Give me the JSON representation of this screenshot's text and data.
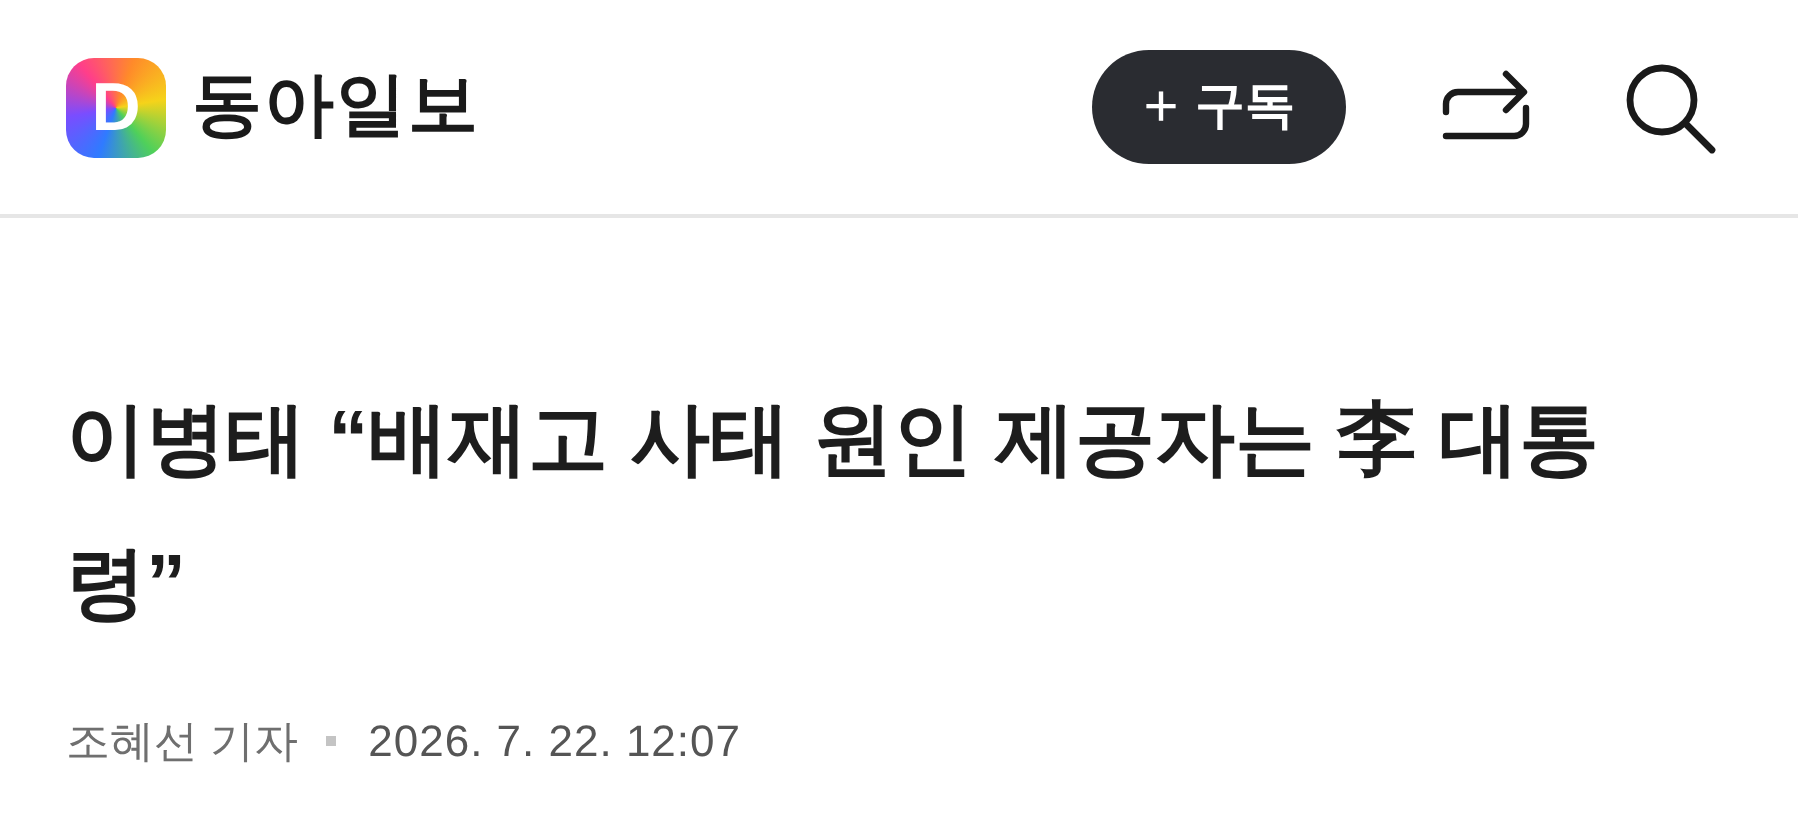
{
  "header": {
    "logo_letter": "D",
    "site_name": "동아일보",
    "subscribe_button": {
      "icon": "+",
      "label": "구독"
    }
  },
  "article": {
    "headline": "이병태 “배재고 사태 원인 제공자는 李 대통령”",
    "author": "조혜선 기자",
    "date": "2026. 7. 22. 12:07"
  }
}
